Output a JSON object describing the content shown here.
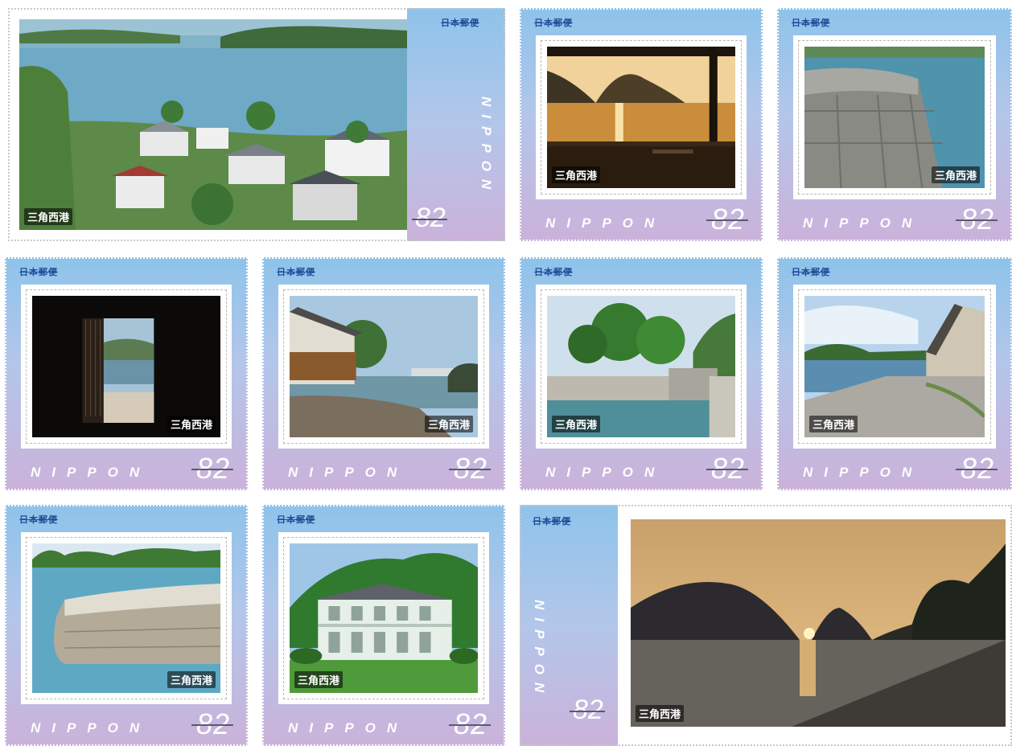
{
  "brand_text": "日本郵便",
  "nippon_text": "NIPPON",
  "denomination": "82",
  "colors": {
    "stamp_top": "#8ec3ea",
    "stamp_bottom": "#cbb2da",
    "brand": "#1f4e9a"
  },
  "stamps": [
    {
      "id": "s1",
      "caption": "三角西港",
      "scene": "harbor-town-aerial"
    },
    {
      "id": "s2",
      "caption": "三角西港",
      "scene": "sunset-veranda"
    },
    {
      "id": "s3",
      "caption": "三角西港",
      "scene": "stone-pier-closeup"
    },
    {
      "id": "s4",
      "caption": "三角西港",
      "scene": "dark-doorway-sea"
    },
    {
      "id": "s5",
      "caption": "三角西港",
      "scene": "warehouse-waterfront"
    },
    {
      "id": "s6",
      "caption": "三角西港",
      "scene": "tree-canal"
    },
    {
      "id": "s7",
      "caption": "三角西港",
      "scene": "stone-quay-building"
    },
    {
      "id": "s8",
      "caption": "三角西港",
      "scene": "stone-breakwater"
    },
    {
      "id": "s9",
      "caption": "三角西港",
      "scene": "white-colonial-house"
    },
    {
      "id": "s10",
      "caption": "三角西港",
      "scene": "sunset-mountains"
    }
  ]
}
